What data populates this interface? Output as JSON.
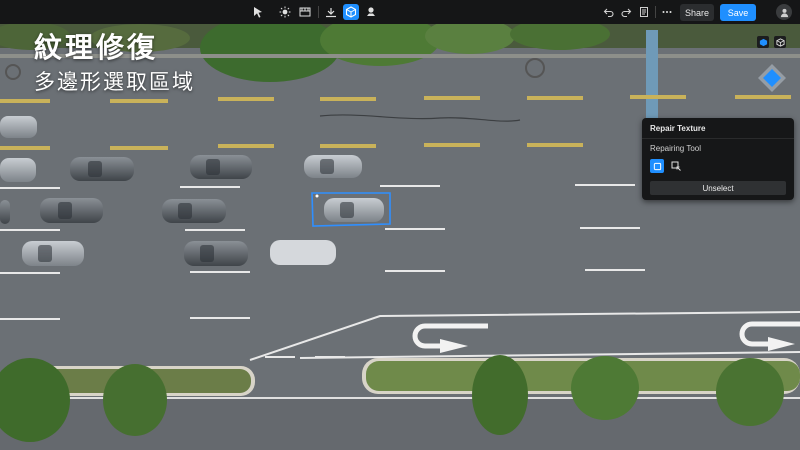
{
  "toolbar": {
    "tools": [
      {
        "name": "select-tool-icon",
        "active": false
      },
      {
        "name": "sun-icon",
        "active": false
      },
      {
        "name": "film-icon",
        "active": false
      },
      {
        "name": "measure-icon",
        "active": false
      },
      {
        "name": "repair-texture-icon",
        "active": true
      },
      {
        "name": "stamp-icon",
        "active": false
      }
    ],
    "undo_icon": "undo-icon",
    "redo_icon": "redo-icon",
    "notes_icon": "notes-icon",
    "more_icon": "more-icon",
    "share_label": "Share",
    "save_label": "Save",
    "accent_color": "#1f8fff"
  },
  "overlay": {
    "title": "紋理修復",
    "subtitle": "多邊形選取區域"
  },
  "panel": {
    "title": "Repair Texture",
    "section_label": "Repairing Tool",
    "tools": [
      "polygon-repair-tool-icon",
      "brush-repair-tool-icon"
    ],
    "unselect_label": "Unselect"
  },
  "scene": {
    "description_icon": "aerial-road-scene",
    "selection_color": "#2f8fff"
  }
}
